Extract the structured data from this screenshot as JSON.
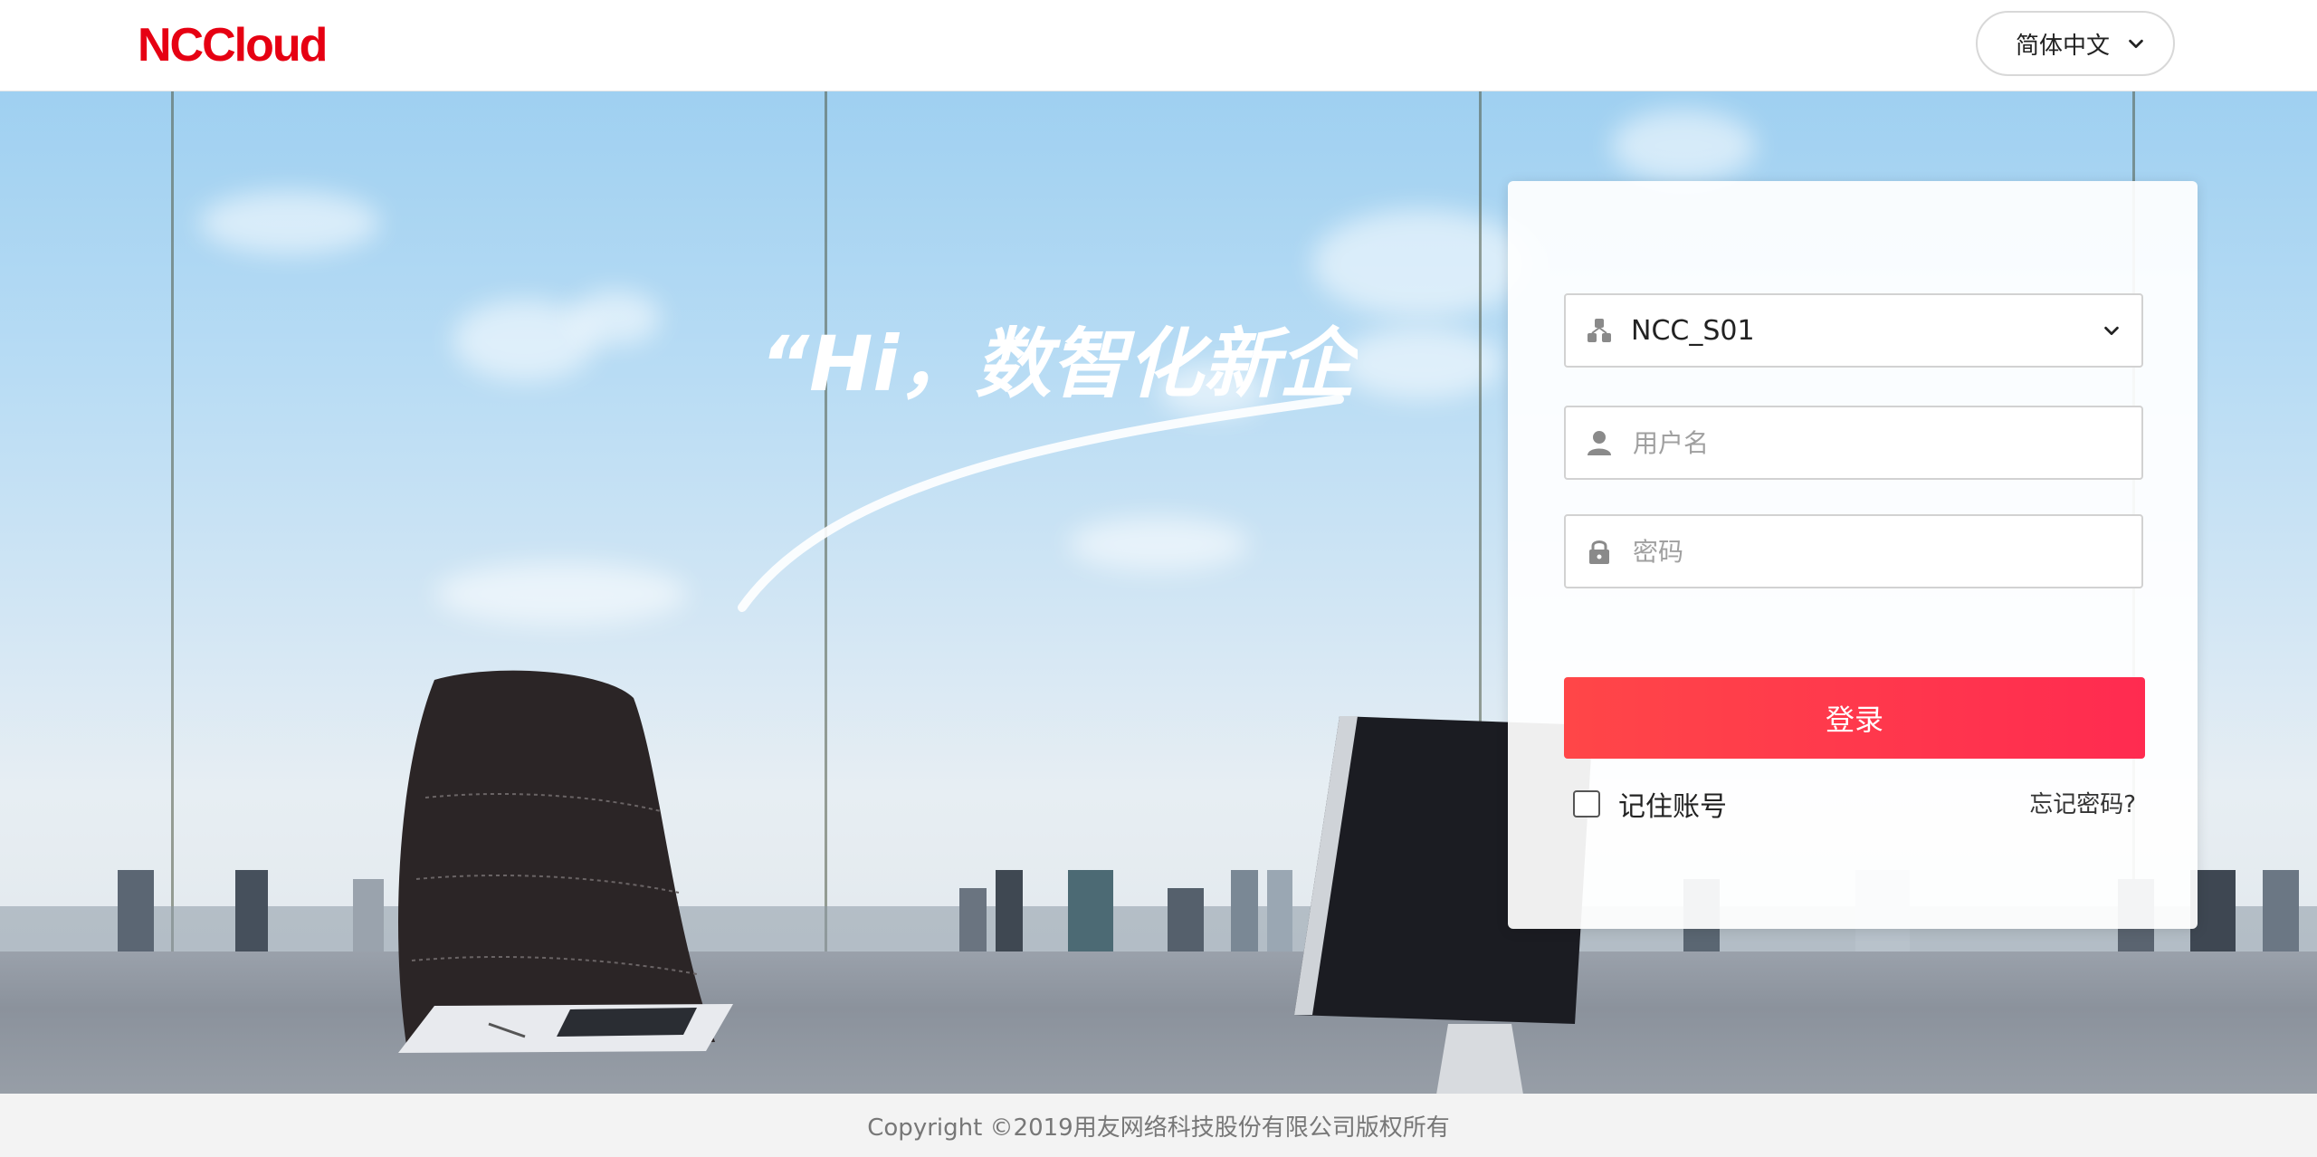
{
  "header": {
    "logo_text": "NCCloud",
    "language": {
      "selected": "简体中文",
      "icon": "chevron-down-icon"
    }
  },
  "hero": {
    "slogan": "“Hi，数智化新企业”"
  },
  "login": {
    "datasource": {
      "value": "NCC_S01",
      "icon": "datasource-icon",
      "dropdown_icon": "chevron-down-icon"
    },
    "username": {
      "placeholder": "用户名",
      "icon": "user-icon"
    },
    "password": {
      "placeholder": "密码",
      "icon": "lock-icon"
    },
    "submit_label": "登录",
    "remember_label": "记住账号",
    "forgot_label": "忘记密码?"
  },
  "footer": {
    "copyright": "Copyright ©2019用友网络科技股份有限公司版权所有"
  },
  "colors": {
    "brand": "#e60012",
    "button": "#ff3b4c",
    "sky": "#a8d5f3",
    "floor": "#8f96a0"
  }
}
